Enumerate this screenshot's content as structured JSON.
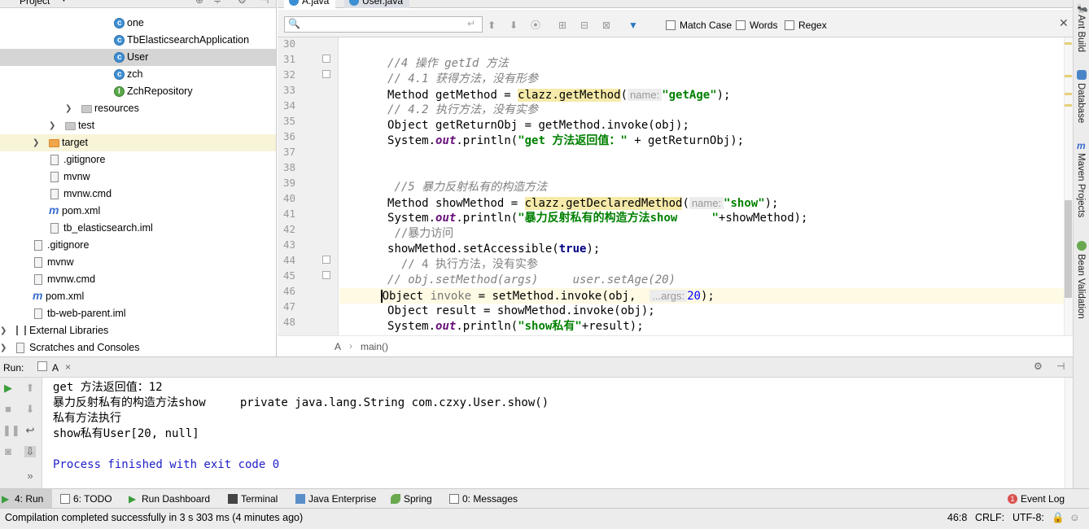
{
  "project_panel": {
    "title": "Project",
    "items": [
      {
        "label": "one",
        "icon": "class-icon",
        "indent": 140
      },
      {
        "label": "TbElasticsearchApplication",
        "icon": "class-icon",
        "indent": 140
      },
      {
        "label": "User",
        "icon": "class-icon",
        "indent": 140,
        "selected": true
      },
      {
        "label": "zch",
        "icon": "class-icon",
        "indent": 140
      },
      {
        "label": "ZchRepository",
        "icon": "interface-icon",
        "indent": 140
      },
      {
        "label": "resources",
        "icon": "folder-icon",
        "indent": 100,
        "arrow": true
      },
      {
        "label": "test",
        "icon": "folder-icon",
        "indent": 80,
        "arrow": true
      },
      {
        "label": "target",
        "icon": "folder-orange-icon",
        "indent": 60,
        "arrow": true,
        "highlight": true
      },
      {
        "label": ".gitignore",
        "icon": "file-icon",
        "indent": 62
      },
      {
        "label": "mvnw",
        "icon": "file-icon",
        "indent": 62
      },
      {
        "label": "mvnw.cmd",
        "icon": "file-icon",
        "indent": 62
      },
      {
        "label": "pom.xml",
        "icon": "maven-icon",
        "indent": 60
      },
      {
        "label": "tb_elasticsearch.iml",
        "icon": "file-icon",
        "indent": 62
      },
      {
        "label": ".gitignore",
        "icon": "file-icon",
        "indent": 42
      },
      {
        "label": "mvnw",
        "icon": "file-icon",
        "indent": 42
      },
      {
        "label": "mvnw.cmd",
        "icon": "file-icon",
        "indent": 42
      },
      {
        "label": "pom.xml",
        "icon": "maven-icon",
        "indent": 40
      },
      {
        "label": "tb-web-parent.iml",
        "icon": "file-icon",
        "indent": 42
      },
      {
        "label": "External Libraries",
        "icon": "library-icon",
        "indent": 20,
        "arrow": true
      },
      {
        "label": "Scratches and Consoles",
        "icon": "scratch-icon",
        "indent": 20,
        "arrow": true
      }
    ]
  },
  "editor": {
    "tabs": [
      {
        "label": "A.java",
        "active": true
      },
      {
        "label": "User.java",
        "active": false
      }
    ],
    "search": {
      "match_case": "Match Case",
      "words": "Words",
      "regex": "Regex"
    },
    "line_numbers": [
      "30",
      "31",
      "32",
      "33",
      "34",
      "35",
      "36",
      "37",
      "38",
      "39",
      "40",
      "41",
      "42",
      "43",
      "44",
      "45",
      "46",
      "47",
      "48"
    ],
    "breadcrumb": {
      "class": "A",
      "method": "main()"
    },
    "code": {
      "l31": "//4 操作 getId 方法",
      "l32": "// 4.1 获得方法，没有形参",
      "l33a": "Method getMethod = ",
      "l33b": "clazz.getMethod",
      "l33c": "(",
      "l33hint": "name:",
      "l33d": "\"getAge\"",
      "l33e": ");",
      "l34": "// 4.2 执行方法，没有实参",
      "l35": "Object getReturnObj = getMethod.invoke(obj);",
      "l36a": "System.",
      "l36b": "out",
      "l36c": ".println(",
      "l36d": "\"get 方法返回值：\"",
      "l36e": " + getReturnObj);",
      "l39": " //5 暴力反射私有的构造方法",
      "l40a": "Method showMethod = ",
      "l40b": "clazz.getDeclaredMethod",
      "l40c": "(",
      "l40hint": "name:",
      "l40d": "\"show\"",
      "l40e": ");",
      "l41a": "System.",
      "l41b": "out",
      "l41c": ".println(",
      "l41d": "\"暴力反射私有的构造方法show     \"",
      "l41e": "+showMethod);",
      "l42": " //暴力访问",
      "l43a": "showMethod.setAccessible(",
      "l43b": "true",
      "l43c": ");",
      "l44": "  // 4 执行方法，没有实参",
      "l45": "// obj.setMethod(args)     user.setAge(20)",
      "l46a": "Object ",
      "l46b": "invoke",
      "l46c": " = setMethod.invoke(obj,  ",
      "l46hint": "...args:",
      "l46d": "20",
      "l46e": ");",
      "l47": "Object result = showMethod.invoke(obj);",
      "l48a": "System.",
      "l48b": "out",
      "l48c": ".println(",
      "l48d": "\"show私有\"",
      "l48e": "+result);"
    }
  },
  "right_strip": [
    "Ant Build",
    "Database",
    "Maven Projects",
    "Bean Validation"
  ],
  "run_panel": {
    "label": "Run:",
    "tab": "A",
    "output": [
      "get 方法返回值：12",
      "暴力反射私有的构造方法show     private java.lang.String com.czxy.User.show()",
      "私有方法执行",
      "show私有User[20, null]",
      "",
      "Process finished with exit code 0"
    ]
  },
  "bottom_tabs": [
    {
      "label": "4: Run",
      "active": true
    },
    {
      "label": "6: TODO"
    },
    {
      "label": "Run Dashboard"
    },
    {
      "label": "Terminal"
    },
    {
      "label": "Java Enterprise"
    },
    {
      "label": "Spring"
    },
    {
      "label": "0: Messages"
    }
  ],
  "event_log": "Event Log",
  "event_count": "1",
  "status": {
    "message": "Compilation completed successfully in 3 s 303 ms (4 minutes ago)",
    "position": "46:8",
    "line_sep": "CRLF:",
    "encoding": "UTF-8:"
  },
  "colors": {
    "accent": "#3d8fd4",
    "run_green": "#3c9e3c",
    "comment": "#808080",
    "string": "#008000",
    "keyword": "#000080"
  }
}
